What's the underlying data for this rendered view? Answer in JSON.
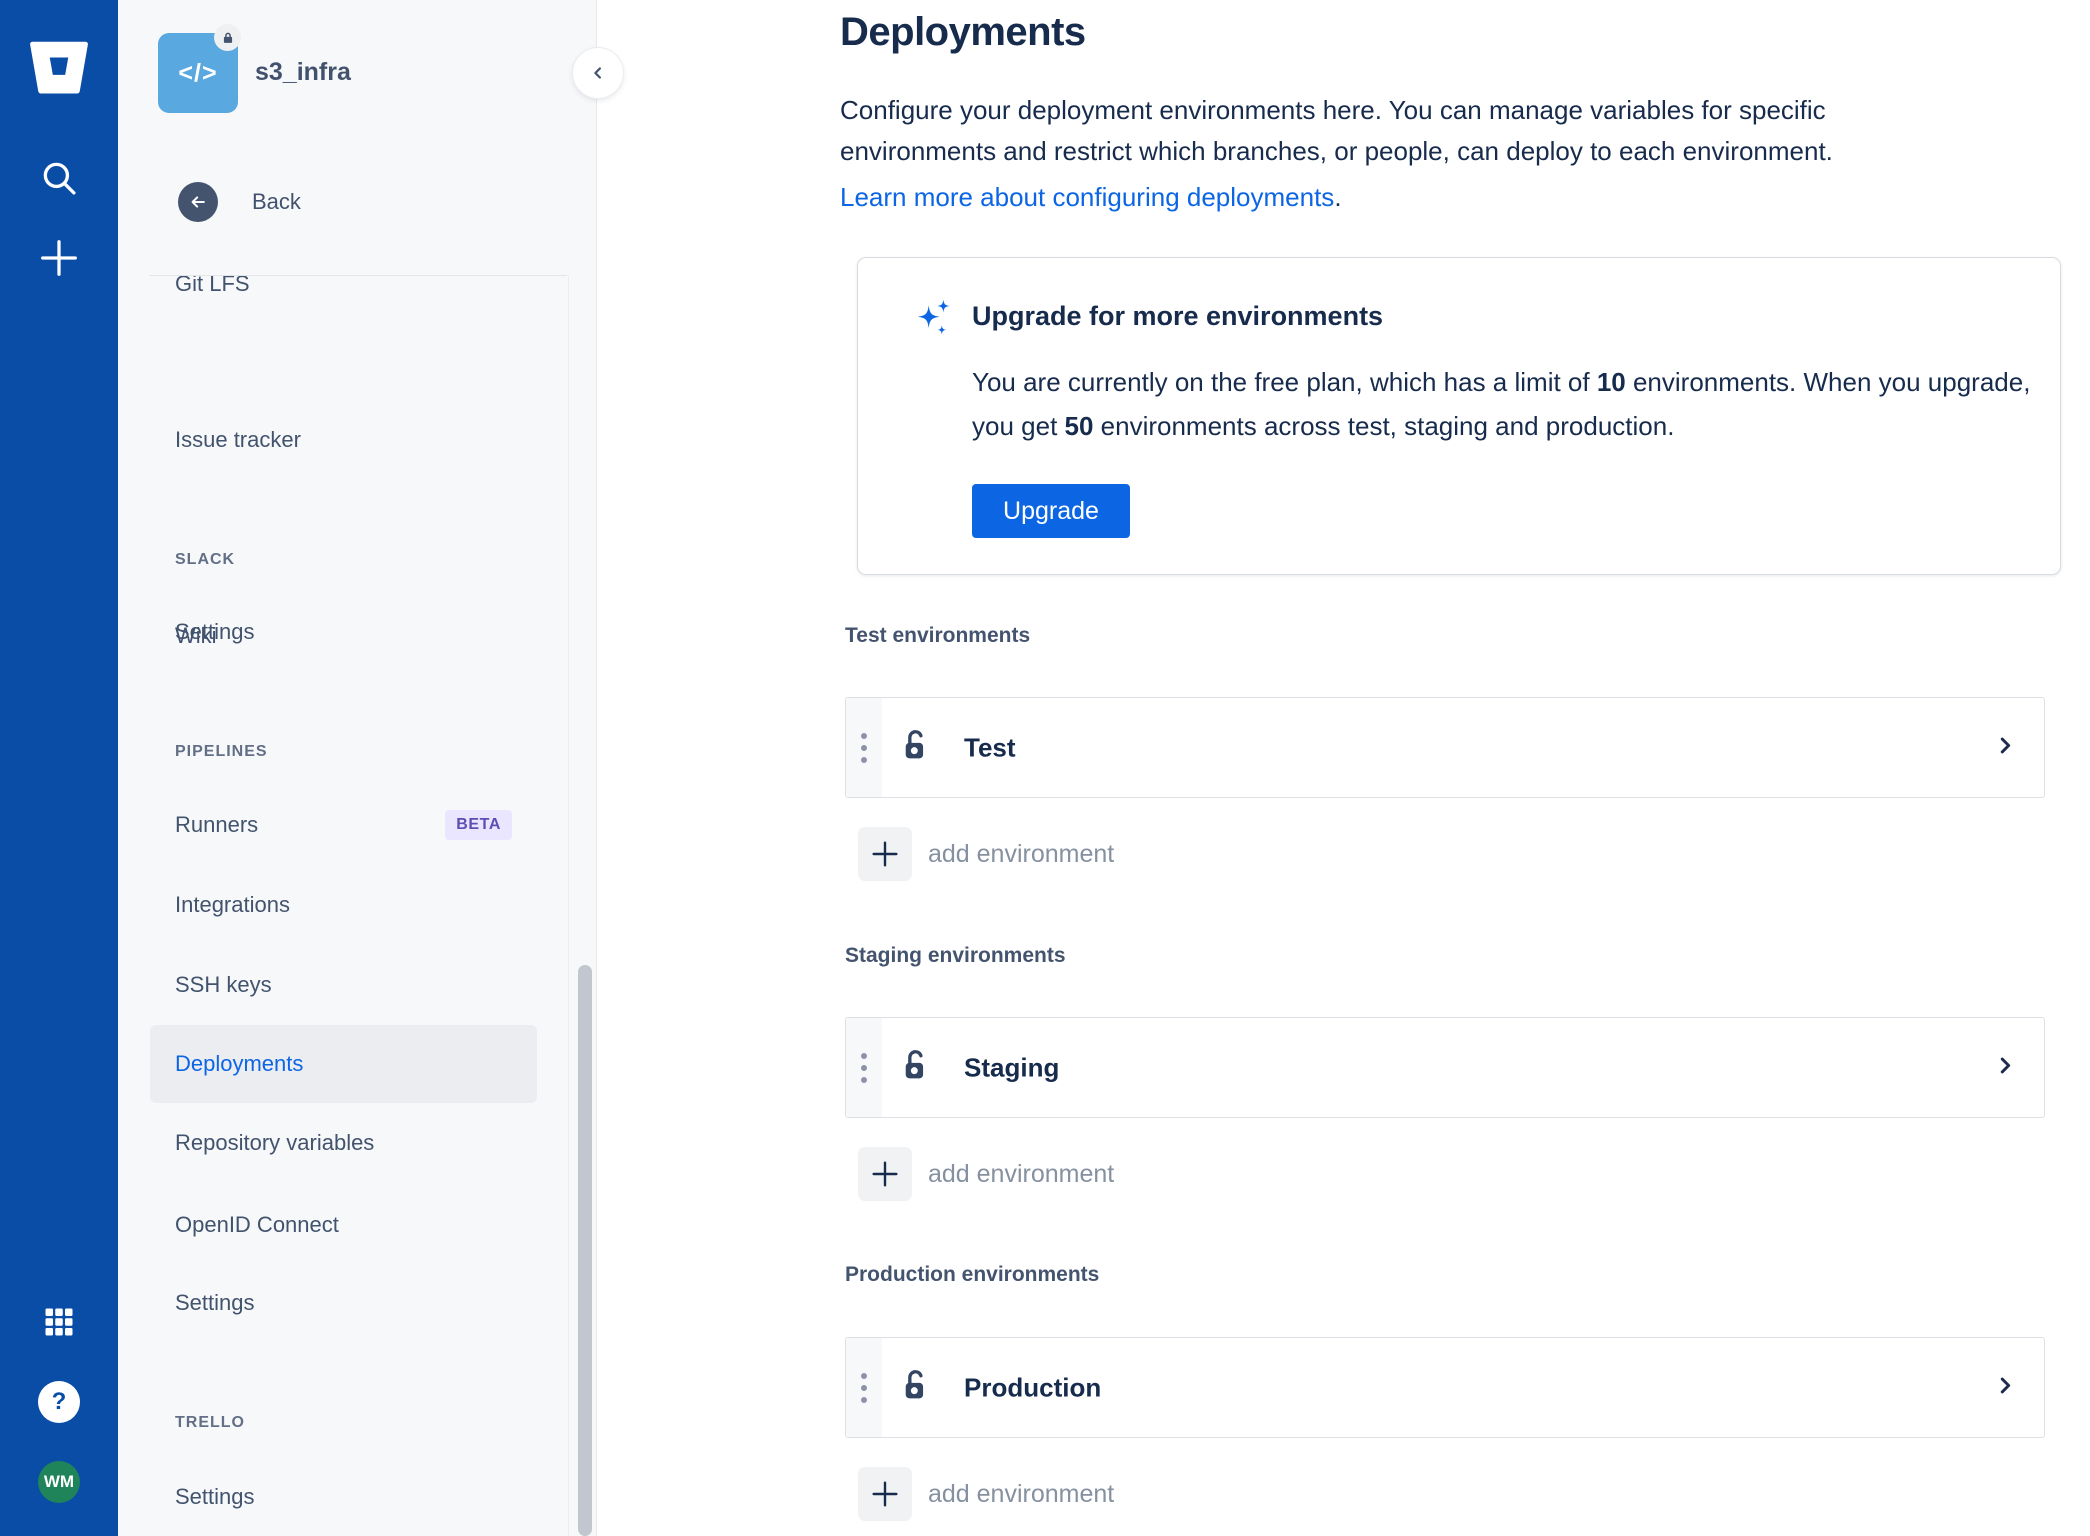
{
  "rail": {
    "help_glyph": "?",
    "avatar_initials": "WM",
    "icons": [
      "bitbucket-logo",
      "search",
      "create-plus",
      "app-switcher-grid",
      "help",
      "user-avatar"
    ]
  },
  "sidebar": {
    "repo_name": "s3_infra",
    "repo_avatar_glyph": "</>",
    "back_label": "Back",
    "items": [
      {
        "type": "item",
        "label": "Git LFS"
      },
      {
        "type": "item",
        "label": "Wiki"
      },
      {
        "type": "item",
        "label": "Issue tracker"
      },
      {
        "type": "header",
        "label": "SLACK"
      },
      {
        "type": "item",
        "label": "Settings"
      },
      {
        "type": "header",
        "label": "PIPELINES"
      },
      {
        "type": "item",
        "label": "Runners",
        "badge": "BETA"
      },
      {
        "type": "item",
        "label": "Integrations"
      },
      {
        "type": "item",
        "label": "SSH keys"
      },
      {
        "type": "item",
        "label": "Deployments",
        "selected": true
      },
      {
        "type": "item",
        "label": "Repository variables"
      },
      {
        "type": "item",
        "label": "OpenID Connect"
      },
      {
        "type": "item",
        "label": "Settings"
      },
      {
        "type": "header",
        "label": "TRELLO"
      },
      {
        "type": "item",
        "label": "Settings"
      }
    ]
  },
  "main": {
    "title": "Deployments",
    "description_line1": "Configure your deployment environments here. You can manage variables for specific",
    "description_line2": "environments and restrict which branches, or people, can deploy to each environment.",
    "learn_more_link": "Learn more about configuring deployments",
    "learn_more_suffix": ".",
    "upgrade_card": {
      "title": "Upgrade for more environments",
      "body_part1": "You are currently on the free plan, which has a limit of ",
      "body_bold1": "10",
      "body_part2": " environments. When you upgrade, you get ",
      "body_bold2": "50",
      "body_part3": " environments across test, staging and production.",
      "button_label": "Upgrade"
    },
    "sections": [
      {
        "label": "Test environments",
        "environment": "Test",
        "add_label": "add environment"
      },
      {
        "label": "Staging environments",
        "environment": "Staging",
        "add_label": "add environment"
      },
      {
        "label": "Production environments",
        "environment": "Production",
        "add_label": "add environment"
      }
    ]
  },
  "colors": {
    "rail_bg": "#0A4DA6",
    "sidebar_bg": "#F7F8F9",
    "accent_blue": "#0C66E4",
    "selected_item_text": "#0C66E4",
    "beta_badge_bg": "#EAE6FF",
    "beta_badge_text": "#5E4DB2",
    "repo_avatar_blue": "#59A8E0",
    "avatar_green": "#1F845A",
    "heading_text": "#172B4D",
    "muted_text": "#626F86"
  }
}
